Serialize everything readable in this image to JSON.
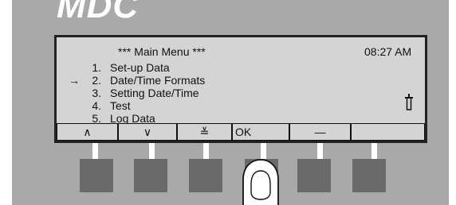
{
  "device": {
    "logo": "MDC"
  },
  "screen": {
    "title": "*** Main Menu ***",
    "time": "08:27 AM",
    "cursor_glyph": "→",
    "menu": [
      {
        "number": "1.",
        "label": "Set-up Data",
        "selected": false
      },
      {
        "number": "2.",
        "label": "Date/Time Formats",
        "selected": true
      },
      {
        "number": "3.",
        "label": "Setting Date/Time",
        "selected": false
      },
      {
        "number": "4.",
        "label": "Test",
        "selected": false
      },
      {
        "number": "5.",
        "label": "Log Data",
        "selected": false
      }
    ],
    "status_icon": "thermometer-icon"
  },
  "softkeys": [
    {
      "label": "∧",
      "icon": "caret-up-icon"
    },
    {
      "label": "∨",
      "icon": "caret-down-icon"
    },
    {
      "label": "≚",
      "icon": "page-down-icon"
    },
    {
      "label": "OK",
      "icon": "ok"
    },
    {
      "label": "—",
      "icon": "minus-icon"
    },
    {
      "label": "",
      "icon": "blank"
    }
  ],
  "pressed_button": "button-4",
  "colors": {
    "panel": "#a9a9a9",
    "lcd": "#d4d4d4",
    "button": "#6a6a6a",
    "text": "#111111"
  }
}
